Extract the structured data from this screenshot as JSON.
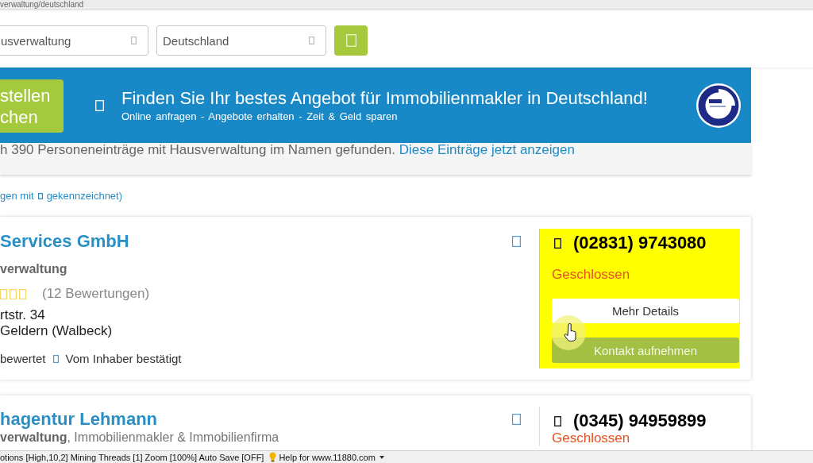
{
  "url_bar": {
    "text": "verwaltung/deutschland"
  },
  "search": {
    "what_field": {
      "value": "usverwaltung"
    },
    "where_field": {
      "value": "Deutschland"
    }
  },
  "banner": {
    "button_lines": [
      "stellen",
      "chen"
    ],
    "title": "Finden Sie Ihr bestes Angebot für Immobilienmakler in Deutschland!",
    "subtitle": "Online anfragen - Angebote erhalten - Zeit & Geld sparen"
  },
  "info": {
    "text": "h 390 Personeneinträge mit Hausverwaltung im Namen gefunden.",
    "link": "Diese Einträge jetzt anzeigen"
  },
  "note": {
    "text_before": "gen mit",
    "text_after": "gekennzeichnet)"
  },
  "listings": [
    {
      "name": "Services GmbH",
      "category": "verwaltung",
      "rating_count": "(12 Bewertungen)",
      "address_lines": [
        "rtstr. 34",
        "Geldern (Walbeck)"
      ],
      "badges": [
        {
          "label": "bewertet",
          "icon": false
        },
        {
          "label": "Vom Inhaber bestätigt",
          "icon": true
        }
      ],
      "phone": "(02831) 9743080",
      "status": "Geschlossen",
      "buttons": [
        {
          "label": "Mehr Details",
          "kind": "secondary"
        },
        {
          "label": "Kontakt aufnehmen",
          "kind": "primary"
        }
      ],
      "highlighted": true
    },
    {
      "name": "hagentur Lehmann",
      "category": "verwaltung",
      "other_categories": ", Immobilienmakler & Immobilienfirma",
      "phone": "(0345) 94959899",
      "status": "Geschlossen",
      "highlighted": false
    }
  ],
  "status_bar": {
    "text": "otions [High,10,2] Mining Threads [1] Zoom [100%] Auto Save [OFF]",
    "help": "Help for www.11880.com"
  }
}
